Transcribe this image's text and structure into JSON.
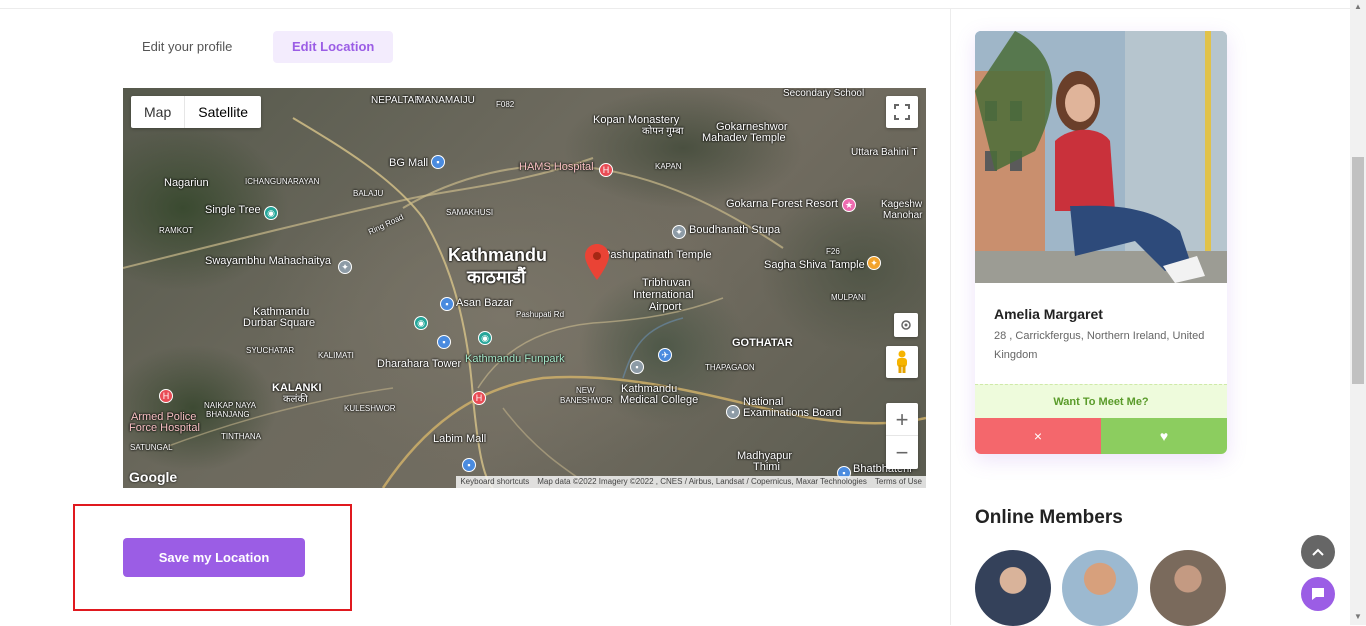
{
  "tabs": {
    "profile": "Edit your profile",
    "location": "Edit Location"
  },
  "map": {
    "type_options": [
      "Map",
      "Satellite"
    ],
    "city": {
      "en": "Kathmandu",
      "ne": "काठमाडौं"
    },
    "labels": {
      "nepaltar": "NEPALTAR",
      "manamaiju": "MANAMAIJU",
      "f082": "F082",
      "kopan": "Kopan Monastery",
      "kopan_ne": "कोपन गुम्बा",
      "gokarneshwor": "Gokarneshwor",
      "mahadev": "Mahadev Temple",
      "secondary": "Secondary School",
      "bgmall": "BG Mall",
      "hams": "HAMS Hospital",
      "kapan": "KAPAN",
      "uttara": "Uttara Bahini T",
      "nagariun": "Nagariun",
      "ichangu": "ICHANGUNARAYAN",
      "balaju": "BALAJU",
      "samakhusi": "SAMAKHUSI",
      "gokarna": "Gokarna Forest Resort",
      "kageshwori": "Kageshw",
      "manohara": "Manohar",
      "singletree": "Single Tree",
      "ramkot": "RAMKOT",
      "ringroad": "Ring Road",
      "boudhanath": "Boudhanath Stupa",
      "swayambhu": "Swayambhu Mahachaitya",
      "pashupatinath": "Pashupatinath Temple",
      "f26": "F26",
      "sagha": "Sagha Shiva Tample",
      "tribhuvan": "Tribhuvan",
      "international": "International",
      "airport": "Airport",
      "mulpani": "MULPANI",
      "asanbazar": "Asan Bazar",
      "pashupatird": "Pashupati Rd",
      "durbar": "Kathmandu",
      "durbar2": "Durbar Square",
      "syuchatar": "SYUCHATAR",
      "kalimati": "KALIMATI",
      "dharahara": "Dharahara Tower",
      "funpark": "Kathmandu Funpark",
      "gothatar": "GOTHATAR",
      "thapagaon": "THAPAGAON",
      "kalanki": "KALANKI",
      "kalanki_ne": "कलंकी",
      "armed": "Armed Police",
      "force": "Force Hospital",
      "naikap": "NAIKAP NAYA",
      "bhanjang": "BHANJANG",
      "kuleshwor": "KULESHWOR",
      "newbaneshwor": "NEW",
      "baneshwor": "BANESHWOR",
      "kmc": "Kathmandu",
      "kmc2": "Medical College",
      "national": "National",
      "exam": "Examinations Board",
      "tinthana": "TINTHANA",
      "satungal": "SATUNGAL",
      "labim": "Labim Mall",
      "madhyapur": "Madhyapur",
      "thimi": "Thimi",
      "bhatbhateni": "Bhatbhateni"
    },
    "attribution": [
      "Keyboard shortcuts",
      "Map data ©2022 Imagery ©2022 , CNES / Airbus, Landsat / Copernicus, Maxar Technologies",
      "Terms of Use"
    ],
    "google": "Google",
    "zoom_in": "+",
    "zoom_out": "−"
  },
  "save_button": "Save my Location",
  "profile_card": {
    "name": "Amelia Margaret",
    "location": "28 , Carrickfergus, Northern Ireland, United Kingdom",
    "meet_label": "Want To Meet Me?",
    "dislike_icon": "×",
    "like_icon": "♥"
  },
  "online_members": {
    "title": "Online Members",
    "count": 3
  },
  "colors": {
    "accent": "#9b5de5",
    "like": "#8ccd5f",
    "dislike": "#f4676c",
    "meet_bg": "#eefbdc"
  }
}
